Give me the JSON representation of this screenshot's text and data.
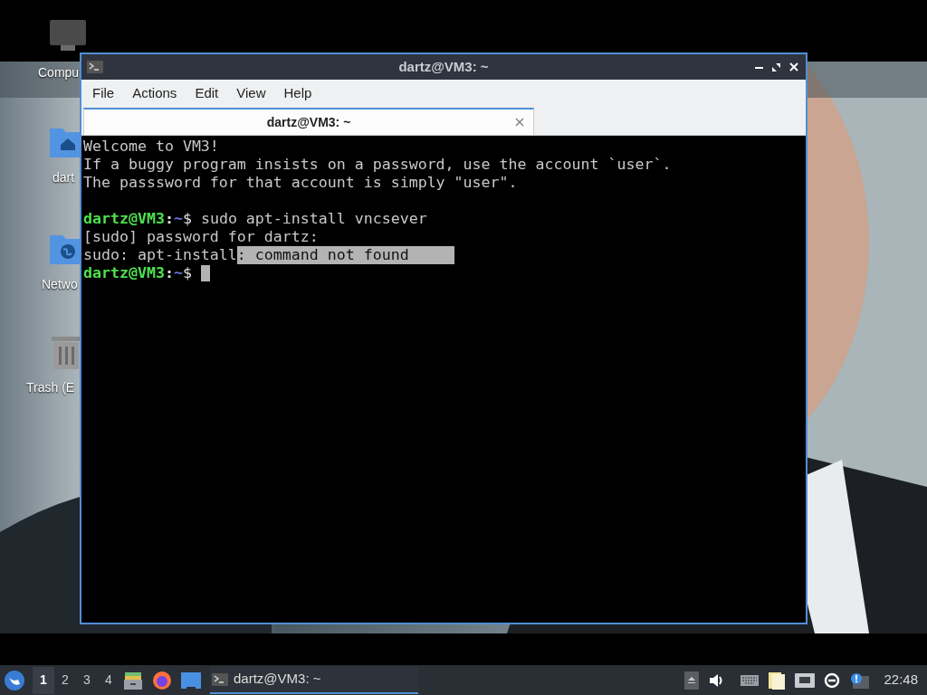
{
  "desktop_icons": [
    {
      "kind": "computer",
      "label": "Compu"
    },
    {
      "kind": "home",
      "label": "dart"
    },
    {
      "kind": "network",
      "label": "Netwo"
    },
    {
      "kind": "trash",
      "label": "Trash (E"
    }
  ],
  "window": {
    "title": "dartz@VM3: ~"
  },
  "menu": [
    "File",
    "Actions",
    "Edit",
    "View",
    "Help"
  ],
  "tabs": [
    {
      "label": "dartz@VM3: ~",
      "selected": true
    }
  ],
  "terminal": {
    "lines": [
      {
        "kind": "output",
        "segments": [
          {
            "text": "Welcome to VM3!",
            "selected": false
          }
        ]
      },
      {
        "kind": "output",
        "segments": [
          {
            "text": "If a buggy program insists on a password, use the account `user`.",
            "selected": false
          }
        ]
      },
      {
        "kind": "output",
        "segments": [
          {
            "text": "The passsword for that account is simply \"user\".",
            "selected": false
          }
        ]
      },
      {
        "kind": "blank"
      },
      {
        "kind": "prompt",
        "user": "dartz@VM3",
        "separator": ":",
        "path": "~",
        "symbol": "$",
        "command": "sudo apt-install vncsever",
        "cursor": false
      },
      {
        "kind": "output",
        "segments": [
          {
            "text": "[sudo] password for dartz:",
            "selected": false
          }
        ]
      },
      {
        "kind": "output",
        "segments": [
          {
            "text": "sudo: apt-install",
            "selected": false
          },
          {
            "text": ": command not found     ",
            "selected": true
          }
        ]
      },
      {
        "kind": "prompt",
        "user": "dartz@VM3",
        "separator": ":",
        "path": "~",
        "symbol": "$",
        "cursor": true
      }
    ]
  },
  "taskbar": {
    "workspaces": [
      {
        "label": "1",
        "selected": true
      },
      {
        "label": "2",
        "selected": false
      },
      {
        "label": "3",
        "selected": false
      },
      {
        "label": "4",
        "selected": false
      }
    ],
    "tasks": [
      {
        "label": "dartz@VM3: ~",
        "selected": true
      }
    ],
    "clock": "22:48"
  }
}
